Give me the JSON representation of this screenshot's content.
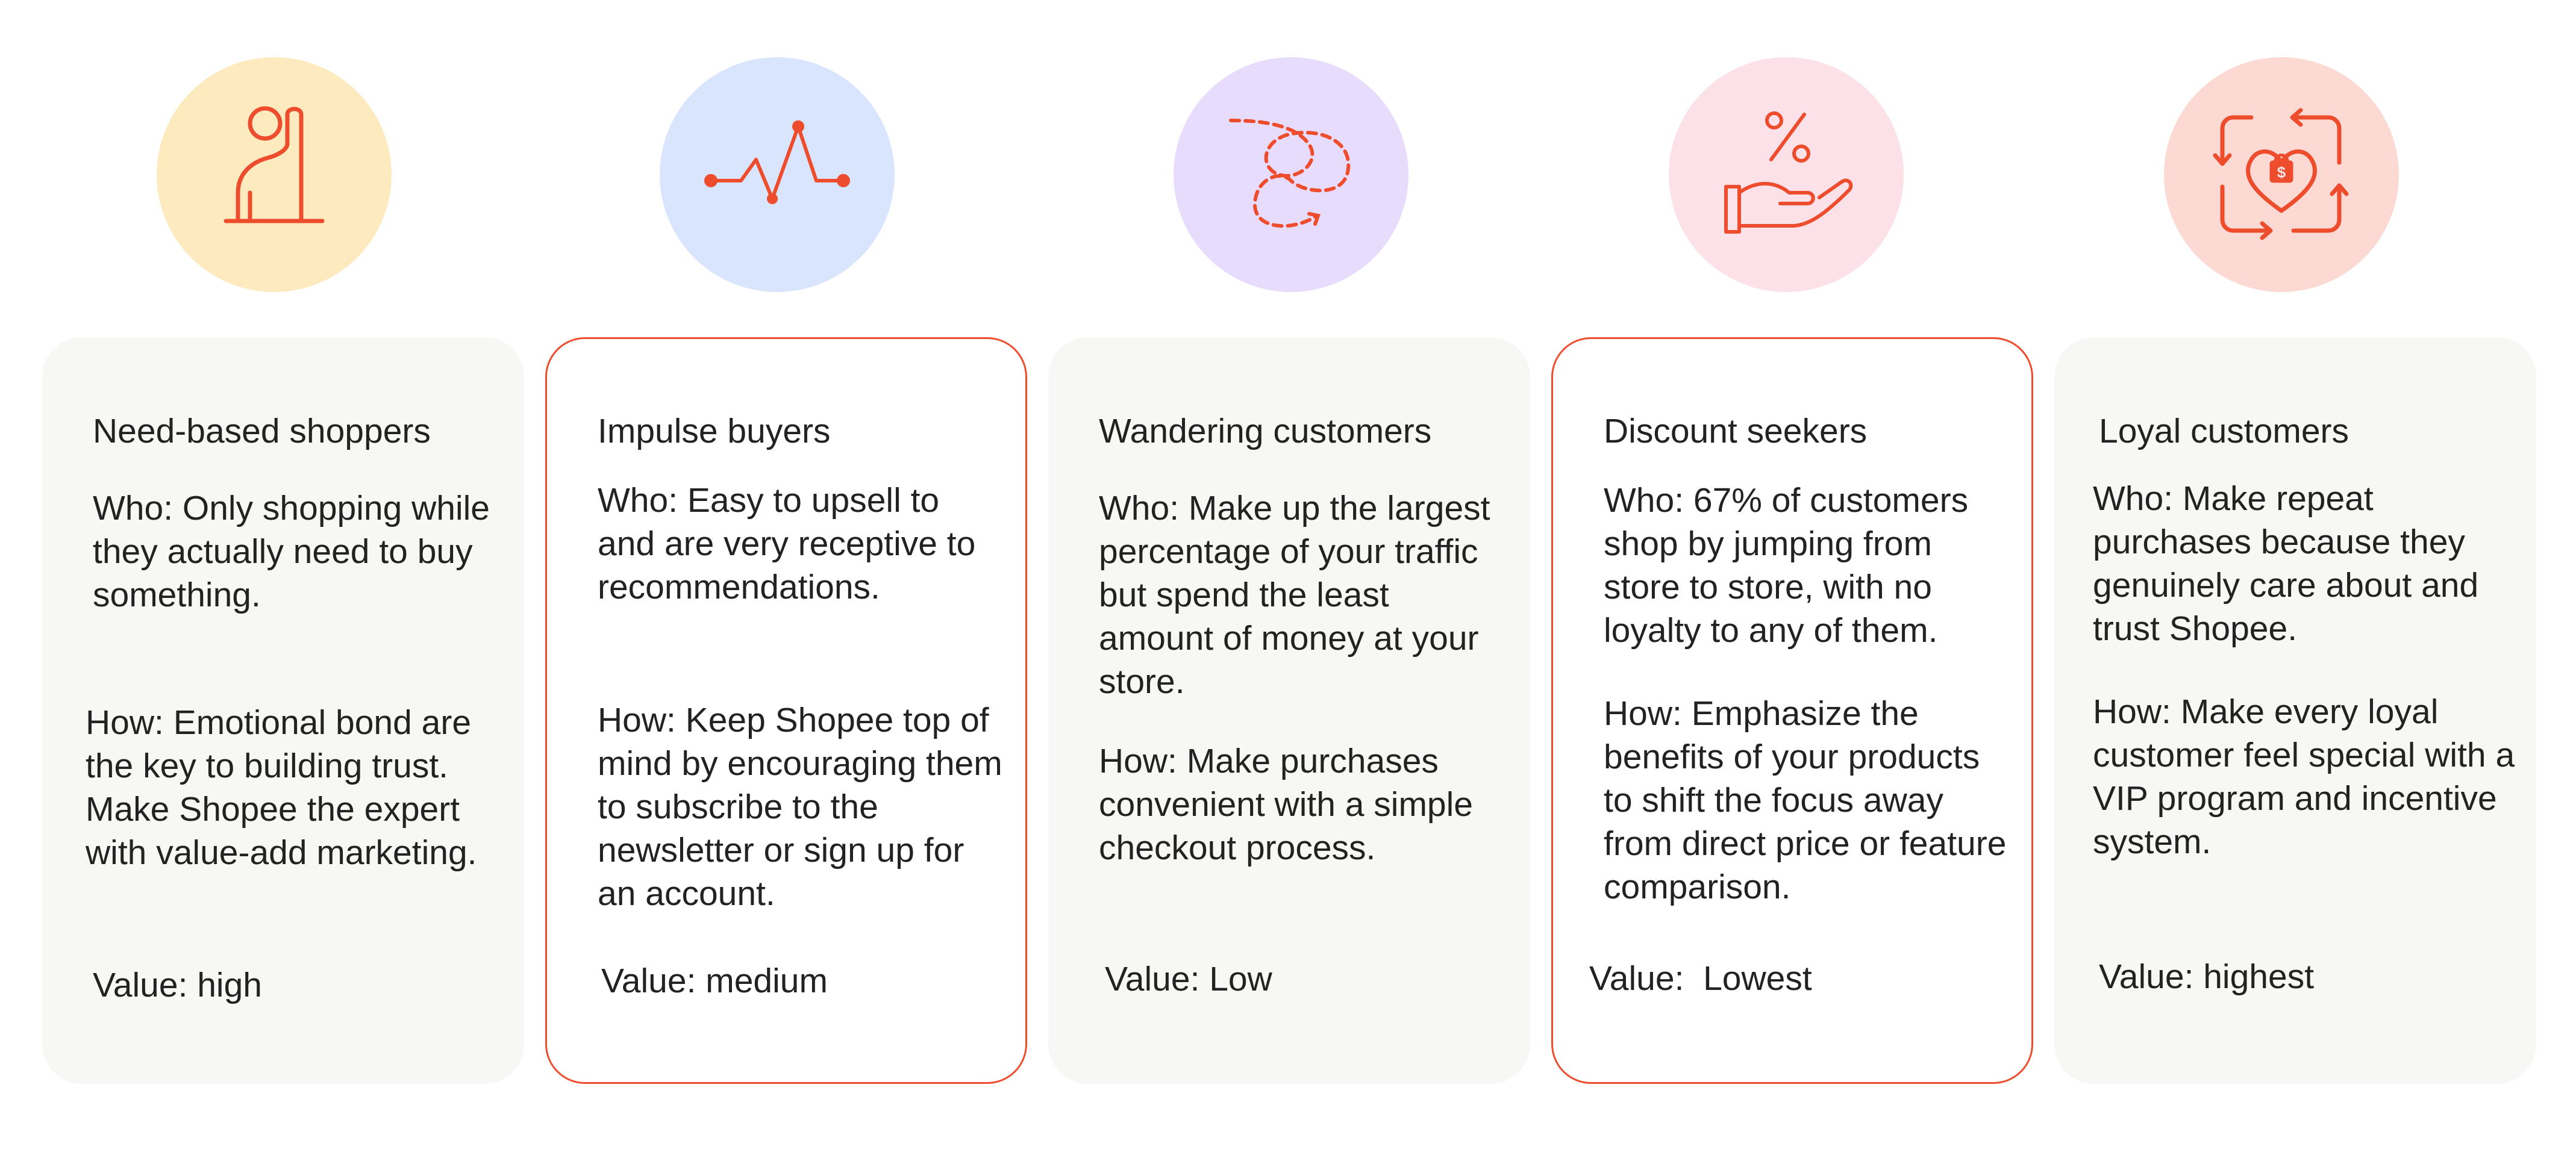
{
  "colors": {
    "accent": "#ee4d2d",
    "card_bg": "#f7f7f5",
    "circles": [
      "#fdebbf",
      "#d9e5fd",
      "#e8dcfd",
      "#fde1e8",
      "#fcdad3"
    ]
  },
  "segments": [
    {
      "icon": "raised-hand-person-icon",
      "title": "Need-based shoppers",
      "who_label": "Who",
      "who": ": Only shopping while they actually need to buy something.",
      "how_label": "How",
      "how": ": Emotional bond are the key to building trust. Make Shopee the expert with value-add marketing.",
      "value_label": "Value",
      "value": ": high"
    },
    {
      "icon": "pulse-line-icon",
      "title": "Impulse buyers",
      "who_label": "Who",
      "who": ": Easy to upsell to and are very receptive to recommendations.",
      "how_label": "How",
      "how": ": Keep Shopee top of mind by encouraging them to subscribe to the newsletter or sign up for an account.",
      "value_label": "Value",
      "value": ": medium"
    },
    {
      "icon": "wandering-path-icon",
      "title": "Wandering customers",
      "who_label": "Who",
      "who": ": Make up the largest percentage of your traffic but spend the least amount of money at your store.",
      "how_label": "How",
      "how": ": Make purchases convenient with a simple checkout process.",
      "value_label": "Value",
      "value": ": Low"
    },
    {
      "icon": "hand-percent-icon",
      "title": "Discount seekers",
      "who_label": "Who",
      "who": ": 67% of customers shop by jumping from store to store, with no loyalty to any of them.",
      "how_label": "How",
      "how": ": Emphasize the benefits of your products to shift the focus away from direct price or feature comparison.",
      "value_label": "Value",
      "value": ":  Lowest"
    },
    {
      "icon": "loyalty-heart-bag-icon",
      "title": "Loyal customers",
      "who_label": "Who",
      "who": ": Make repeat purchases because they genuinely care about and trust Shopee.",
      "how_label": "How",
      "how": ": Make every loyal customer feel special with a VIP program and incentive system.",
      "value_label": "Value",
      "value": ": highest",
      "icon_badge": "$"
    }
  ]
}
